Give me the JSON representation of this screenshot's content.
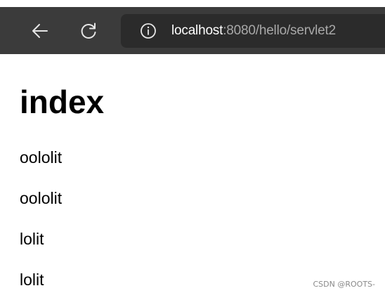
{
  "browser": {
    "url": {
      "host": "localhost",
      "rest": ":8080/hello/servlet2"
    },
    "icons": {
      "back": "back-arrow-icon",
      "reload": "reload-icon",
      "info": "info-icon"
    },
    "colors": {
      "toolbar_bg": "#3b3b3b",
      "address_bg": "#2b2b2b",
      "host_text": "#ffffff",
      "path_text": "#a8a8a8"
    }
  },
  "page": {
    "heading": "index",
    "lines": [
      "oololit",
      "oololit",
      "lolit",
      "lolit"
    ]
  },
  "watermark": "CSDN @ROOTS-"
}
